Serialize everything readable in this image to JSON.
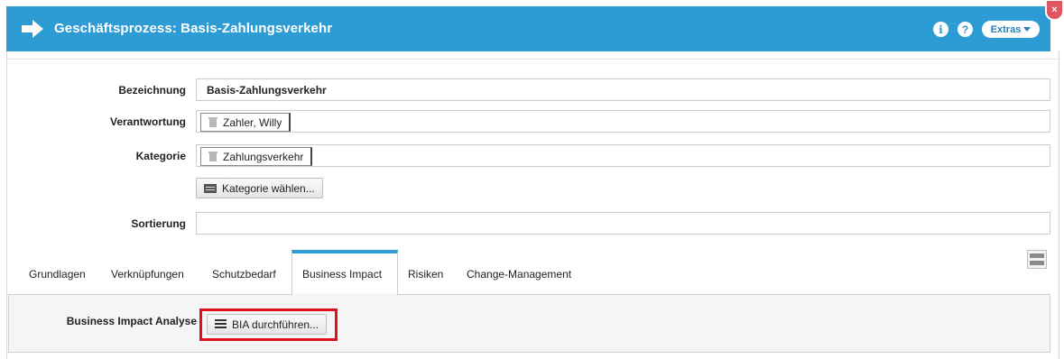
{
  "header": {
    "title": "Geschäftsprozess: Basis-Zahlungsverkehr",
    "extras_label": "Extras",
    "info_icon": "info-icon",
    "help_icon": "help-icon",
    "close_label": "×",
    "accent_color": "#2d9bd4"
  },
  "form": {
    "bezeichnung": {
      "label": "Bezeichnung",
      "value": "Basis-Zahlungsverkehr"
    },
    "verantwortung": {
      "label": "Verantwortung",
      "chip": "Zahler, Willy"
    },
    "kategorie": {
      "label": "Kategorie",
      "chip": "Zahlungsverkehr",
      "choose_button": "Kategorie wählen..."
    },
    "sortierung": {
      "label": "Sortierung",
      "value": ""
    }
  },
  "tabs": [
    {
      "label": "Grundlagen"
    },
    {
      "label": "Verknüpfungen"
    },
    {
      "label": "Schutzbedarf"
    },
    {
      "label": "Business Impact",
      "active": true
    },
    {
      "label": "Risiken"
    },
    {
      "label": "Change-Management"
    }
  ],
  "business_impact": {
    "label": "Business Impact Analyse",
    "button": "BIA durchführen..."
  },
  "highlight_color": "#e0101c"
}
